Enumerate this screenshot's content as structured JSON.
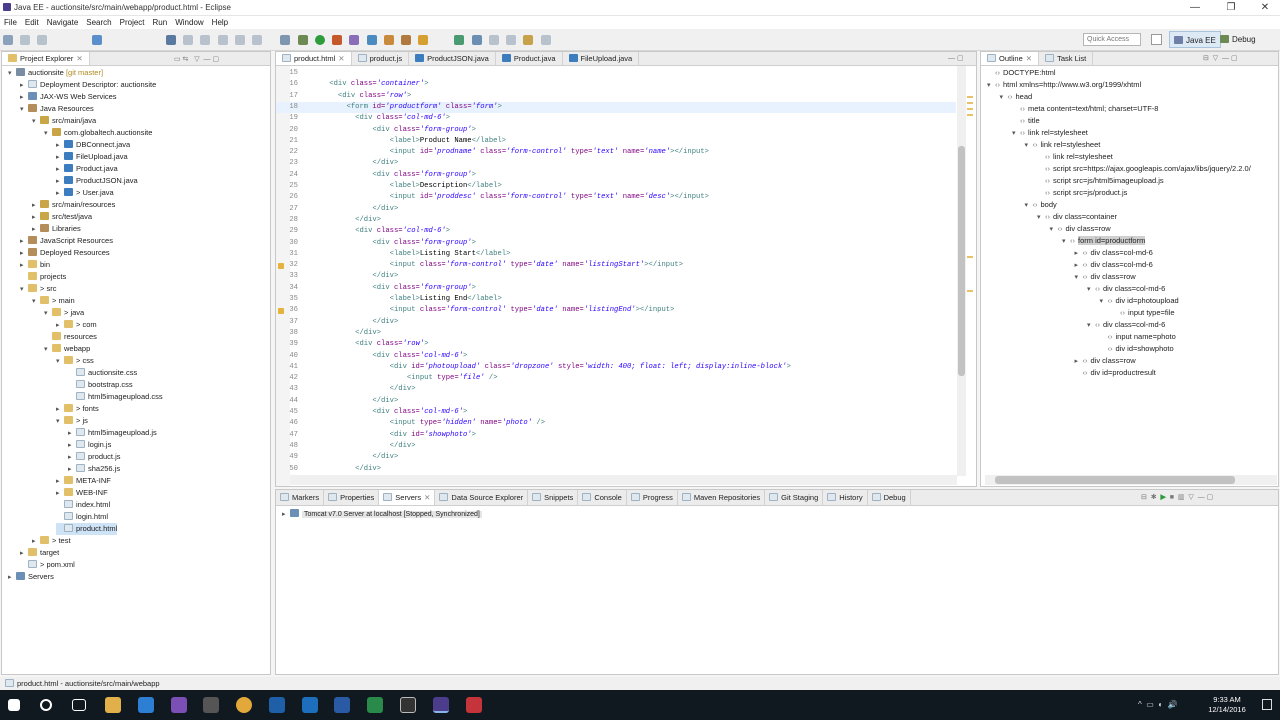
{
  "window": {
    "title": "Java EE - auctionsite/src/main/webapp/product.html - Eclipse"
  },
  "menu": [
    "File",
    "Edit",
    "Navigate",
    "Search",
    "Project",
    "Run",
    "Window",
    "Help"
  ],
  "quick_access": {
    "placeholder": "Quick Access"
  },
  "perspectives": [
    {
      "label": "Java EE",
      "active": true
    },
    {
      "label": "Debug",
      "active": false
    }
  ],
  "explorer": {
    "tab": "Project Explorer",
    "rows": [
      {
        "d": 0,
        "tw": "▾",
        "icon": "proj",
        "label": "auctionsite",
        "suffix": " [git master]"
      },
      {
        "d": 1,
        "tw": "▸",
        "icon": "file",
        "label": "Deployment Descriptor: auctionsite"
      },
      {
        "d": 1,
        "tw": "▸",
        "icon": "srv",
        "label": "JAX-WS Web Services"
      },
      {
        "d": 1,
        "tw": "▾",
        "icon": "lib",
        "label": "Java Resources"
      },
      {
        "d": 2,
        "tw": "▾",
        "icon": "pkg",
        "label": "src/main/java"
      },
      {
        "d": 3,
        "tw": "▾",
        "icon": "pkg",
        "label": "com.globaltech.auctionsite"
      },
      {
        "d": 4,
        "tw": "▸",
        "icon": "java",
        "label": "DBConnect.java"
      },
      {
        "d": 4,
        "tw": "▸",
        "icon": "java",
        "label": "FileUpload.java"
      },
      {
        "d": 4,
        "tw": "▸",
        "icon": "java",
        "label": "Product.java"
      },
      {
        "d": 4,
        "tw": "▸",
        "icon": "java",
        "label": "ProductJSON.java"
      },
      {
        "d": 4,
        "tw": "▸",
        "icon": "java",
        "label": "> User.java"
      },
      {
        "d": 2,
        "tw": "▸",
        "icon": "pkg",
        "label": "src/main/resources"
      },
      {
        "d": 2,
        "tw": "▸",
        "icon": "pkg",
        "label": "src/test/java"
      },
      {
        "d": 2,
        "tw": "▸",
        "icon": "lib",
        "label": "Libraries"
      },
      {
        "d": 1,
        "tw": "▸",
        "icon": "lib",
        "label": "JavaScript Resources"
      },
      {
        "d": 1,
        "tw": "▸",
        "icon": "lib",
        "label": "Deployed Resources"
      },
      {
        "d": 1,
        "tw": "▸",
        "icon": "fold",
        "label": "bin"
      },
      {
        "d": 1,
        "tw": "",
        "icon": "fold",
        "label": "projects"
      },
      {
        "d": 1,
        "tw": "▾",
        "icon": "fold",
        "label": "> src"
      },
      {
        "d": 2,
        "tw": "▾",
        "icon": "fold",
        "label": "> main"
      },
      {
        "d": 3,
        "tw": "▾",
        "icon": "fold",
        "label": "> java"
      },
      {
        "d": 4,
        "tw": "▸",
        "icon": "fold",
        "label": "> com"
      },
      {
        "d": 3,
        "tw": "",
        "icon": "fold",
        "label": "resources"
      },
      {
        "d": 3,
        "tw": "▾",
        "icon": "fold",
        "label": "webapp"
      },
      {
        "d": 4,
        "tw": "▾",
        "icon": "fold",
        "label": "> css"
      },
      {
        "d": 5,
        "tw": "",
        "icon": "file",
        "label": "auctionsite.css"
      },
      {
        "d": 5,
        "tw": "",
        "icon": "file",
        "label": "bootstrap.css"
      },
      {
        "d": 5,
        "tw": "",
        "icon": "file",
        "label": "html5imageupload.css"
      },
      {
        "d": 4,
        "tw": "▸",
        "icon": "fold",
        "label": "> fonts"
      },
      {
        "d": 4,
        "tw": "▾",
        "icon": "fold",
        "label": "> js"
      },
      {
        "d": 5,
        "tw": "▸",
        "icon": "file",
        "label": "html5imageupload.js"
      },
      {
        "d": 5,
        "tw": "▸",
        "icon": "file",
        "label": "login.js"
      },
      {
        "d": 5,
        "tw": "▸",
        "icon": "file",
        "label": "product.js"
      },
      {
        "d": 5,
        "tw": "▸",
        "icon": "file",
        "label": "sha256.js"
      },
      {
        "d": 4,
        "tw": "▸",
        "icon": "fold",
        "label": "META-INF"
      },
      {
        "d": 4,
        "tw": "▸",
        "icon": "fold",
        "label": "WEB-INF"
      },
      {
        "d": 4,
        "tw": "",
        "icon": "file",
        "label": "index.html"
      },
      {
        "d": 4,
        "tw": "",
        "icon": "file",
        "label": "login.html"
      },
      {
        "d": 4,
        "tw": "",
        "icon": "file",
        "label": "product.html",
        "selected": true
      },
      {
        "d": 2,
        "tw": "▸",
        "icon": "fold",
        "label": "> test"
      },
      {
        "d": 1,
        "tw": "▸",
        "icon": "fold",
        "label": "target"
      },
      {
        "d": 1,
        "tw": "",
        "icon": "file",
        "label": "> pom.xml"
      },
      {
        "d": 0,
        "tw": "▸",
        "icon": "srv",
        "label": "Servers"
      }
    ]
  },
  "editor": {
    "tabs": [
      {
        "label": "product.html",
        "active": true
      },
      {
        "label": "product.js"
      },
      {
        "label": "ProductJSON.java"
      },
      {
        "label": "Product.java"
      },
      {
        "label": "FileUpload.java"
      }
    ],
    "lines": [
      {
        "n": "15",
        "html": ""
      },
      {
        "n": "16",
        "html": "    <span class='tag'>&lt;div</span> <span class='attr'>class=</span><span class='val'>'container'</span><span class='tag'>&gt;</span>"
      },
      {
        "n": "17",
        "html": "      <span class='tag'>&lt;div</span> <span class='attr'>class=</span><span class='val'>'row'</span><span class='tag'>&gt;</span>"
      },
      {
        "n": "18",
        "html": "        <span class='tag'>&lt;form</span> <span class='attr'>id=</span><span class='val'>'productform'</span> <span class='attr'>class=</span><span class='val'>'form'</span><span class='tag'>&gt;</span>",
        "current": true
      },
      {
        "n": "19",
        "html": "          <span class='tag'>&lt;div</span> <span class='attr'>class=</span><span class='val'>'col-md-6'</span><span class='tag'>&gt;</span>"
      },
      {
        "n": "20",
        "html": "              <span class='tag'>&lt;div</span> <span class='attr'>class=</span><span class='val'>'form-group'</span><span class='tag'>&gt;</span>"
      },
      {
        "n": "21",
        "html": "                  <span class='tag'>&lt;label&gt;</span><span class='txt'>Product Name</span><span class='tag'>&lt;/label&gt;</span>"
      },
      {
        "n": "22",
        "html": "                  <span class='tag'>&lt;input</span> <span class='attr'>id=</span><span class='val'>'prodname'</span> <span class='attr'>class=</span><span class='val'>'form-control'</span> <span class='attr'>type=</span><span class='val'>'text'</span> <span class='attr'>name=</span><span class='val'>'name'</span><span class='tag'>&gt;&lt;/input&gt;</span>"
      },
      {
        "n": "23",
        "html": "              <span class='tag'>&lt;/div&gt;</span>"
      },
      {
        "n": "24",
        "html": "              <span class='tag'>&lt;div</span> <span class='attr'>class=</span><span class='val'>'form-group'</span><span class='tag'>&gt;</span>"
      },
      {
        "n": "25",
        "html": "                  <span class='tag'>&lt;label&gt;</span><span class='txt'>Description</span><span class='tag'>&lt;/label&gt;</span>"
      },
      {
        "n": "26",
        "html": "                  <span class='tag'>&lt;input</span> <span class='attr'>id=</span><span class='val'>'proddesc'</span> <span class='attr'>class=</span><span class='val'>'form-control'</span> <span class='attr'>type=</span><span class='val'>'text'</span> <span class='attr'>name=</span><span class='val'>'desc'</span><span class='tag'>&gt;&lt;/input&gt;</span>"
      },
      {
        "n": "27",
        "html": "              <span class='tag'>&lt;/div&gt;</span>"
      },
      {
        "n": "28",
        "html": "          <span class='tag'>&lt;/div&gt;</span>"
      },
      {
        "n": "29",
        "html": "          <span class='tag'>&lt;div</span> <span class='attr'>class=</span><span class='val'>'col-md-6'</span><span class='tag'>&gt;</span>"
      },
      {
        "n": "30",
        "html": "              <span class='tag'>&lt;div</span> <span class='attr'>class=</span><span class='val'>'form-group'</span><span class='tag'>&gt;</span>"
      },
      {
        "n": "31",
        "html": "                  <span class='tag'>&lt;label&gt;</span><span class='txt'>Listing Start</span><span class='tag'>&lt;/label&gt;</span>"
      },
      {
        "n": "32",
        "html": "                  <span class='tag'>&lt;input</span> <span class='attr'>class=</span><span class='val'>'form-control'</span> <span class='attr'>type=</span><span class='val'>'date'</span> <span class='attr'>name=</span><span class='val'>'listingStart'</span><span class='tag'>&gt;&lt;/input&gt;</span>",
        "warn": true
      },
      {
        "n": "33",
        "html": "              <span class='tag'>&lt;/div&gt;</span>"
      },
      {
        "n": "34",
        "html": "              <span class='tag'>&lt;div</span> <span class='attr'>class=</span><span class='val'>'form-group'</span><span class='tag'>&gt;</span>"
      },
      {
        "n": "35",
        "html": "                  <span class='tag'>&lt;label&gt;</span><span class='txt'>Listing End</span><span class='tag'>&lt;/label&gt;</span>"
      },
      {
        "n": "36",
        "html": "                  <span class='tag'>&lt;input</span> <span class='attr'>class=</span><span class='val'>'form-control'</span> <span class='attr'>type=</span><span class='val'>'date'</span> <span class='attr'>name=</span><span class='val'>'listingEnd'</span><span class='tag'>&gt;&lt;/input&gt;</span>",
        "warn": true
      },
      {
        "n": "37",
        "html": "              <span class='tag'>&lt;/div&gt;</span>"
      },
      {
        "n": "38",
        "html": "          <span class='tag'>&lt;/div&gt;</span>"
      },
      {
        "n": "39",
        "html": "          <span class='tag'>&lt;div</span> <span class='attr'>class=</span><span class='val'>'row'</span><span class='tag'>&gt;</span>"
      },
      {
        "n": "40",
        "html": "              <span class='tag'>&lt;div</span> <span class='attr'>class=</span><span class='val'>'col-md-6'</span><span class='tag'>&gt;</span>"
      },
      {
        "n": "41",
        "html": "                  <span class='tag'>&lt;div</span> <span class='attr'>id=</span><span class='val'>'photoupload'</span> <span class='attr'>class=</span><span class='val'>'dropzone'</span> <span class='attr'>style=</span><span class='val'>'width: 400; float: left; display:inline-block'</span><span class='tag'>&gt;</span>"
      },
      {
        "n": "42",
        "html": "                      <span class='tag'>&lt;input</span> <span class='attr'>type=</span><span class='val'>'file'</span> <span class='tag'>/&gt;</span>"
      },
      {
        "n": "43",
        "html": "                  <span class='tag'>&lt;/div&gt;</span>"
      },
      {
        "n": "44",
        "html": "              <span class='tag'>&lt;/div&gt;</span>"
      },
      {
        "n": "45",
        "html": "              <span class='tag'>&lt;div</span> <span class='attr'>class=</span><span class='val'>'col-md-6'</span><span class='tag'>&gt;</span>"
      },
      {
        "n": "46",
        "html": "                  <span class='tag'>&lt;input</span> <span class='attr'>type=</span><span class='val'>'hidden'</span> <span class='attr'>name=</span><span class='val'>'photo'</span> <span class='tag'>/&gt;</span>"
      },
      {
        "n": "47",
        "html": "                  <span class='tag'>&lt;div</span> <span class='attr'>id=</span><span class='val'>'showphoto'</span><span class='tag'>&gt;</span>"
      },
      {
        "n": "48",
        "html": "                  <span class='tag'>&lt;/div&gt;</span>"
      },
      {
        "n": "49",
        "html": "              <span class='tag'>&lt;/div&gt;</span>"
      },
      {
        "n": "50",
        "html": "          <span class='tag'>&lt;/div&gt;</span>"
      }
    ]
  },
  "outline": {
    "tabs": [
      {
        "label": "Outline",
        "active": true
      },
      {
        "label": "Task List"
      }
    ],
    "rows": [
      {
        "d": 0,
        "tw": "",
        "label": "DOCTYPE:html"
      },
      {
        "d": 0,
        "tw": "▾",
        "label": "html xmlns=http://www.w3.org/1999/xhtml"
      },
      {
        "d": 1,
        "tw": "▾",
        "label": "head"
      },
      {
        "d": 2,
        "tw": "",
        "label": "meta content=text/html; charset=UTF-8"
      },
      {
        "d": 2,
        "tw": "",
        "label": "title"
      },
      {
        "d": 2,
        "tw": "▾",
        "label": "link rel=stylesheet"
      },
      {
        "d": 3,
        "tw": "▾",
        "label": "link rel=stylesheet"
      },
      {
        "d": 4,
        "tw": "",
        "label": "link rel=stylesheet"
      },
      {
        "d": 4,
        "tw": "",
        "label": "script src=https://ajax.googleapis.com/ajax/libs/jquery/2.2.0/"
      },
      {
        "d": 4,
        "tw": "",
        "label": "script src=js/html5imageupload.js"
      },
      {
        "d": 4,
        "tw": "",
        "label": "script src=js/product.js"
      },
      {
        "d": 3,
        "tw": "▾",
        "label": "body"
      },
      {
        "d": 4,
        "tw": "▾",
        "label": "div class=container"
      },
      {
        "d": 5,
        "tw": "▾",
        "label": "div class=row"
      },
      {
        "d": 6,
        "tw": "▾",
        "label": "form id=productform",
        "selected": true
      },
      {
        "d": 7,
        "tw": "▸",
        "label": "div class=col-md-6"
      },
      {
        "d": 7,
        "tw": "▸",
        "label": "div class=col-md-6"
      },
      {
        "d": 7,
        "tw": "▾",
        "label": "div class=row"
      },
      {
        "d": 8,
        "tw": "▾",
        "label": "div class=col-md-6"
      },
      {
        "d": 9,
        "tw": "▾",
        "label": "div id=photoupload"
      },
      {
        "d": 10,
        "tw": "",
        "label": "input type=file"
      },
      {
        "d": 8,
        "tw": "▾",
        "label": "div class=col-md-6"
      },
      {
        "d": 9,
        "tw": "",
        "label": "input name=photo"
      },
      {
        "d": 9,
        "tw": "",
        "label": "div id=showphoto"
      },
      {
        "d": 7,
        "tw": "▸",
        "label": "div class=row"
      },
      {
        "d": 7,
        "tw": "",
        "label": "div id=productresult"
      }
    ]
  },
  "bottom": {
    "tabs": [
      {
        "label": "Markers"
      },
      {
        "label": "Properties"
      },
      {
        "label": "Servers",
        "active": true
      },
      {
        "label": "Data Source Explorer"
      },
      {
        "label": "Snippets"
      },
      {
        "label": "Console"
      },
      {
        "label": "Progress"
      },
      {
        "label": "Maven Repositories"
      },
      {
        "label": "Git Staging"
      },
      {
        "label": "History"
      },
      {
        "label": "Debug"
      }
    ],
    "server": "Tomcat v7.0 Server at localhost  [Stopped, Synchronized]"
  },
  "status": {
    "text": "product.html - auctionsite/src/main/webapp"
  },
  "clock": {
    "time": "9:33 AM",
    "date": "12/14/2016"
  }
}
